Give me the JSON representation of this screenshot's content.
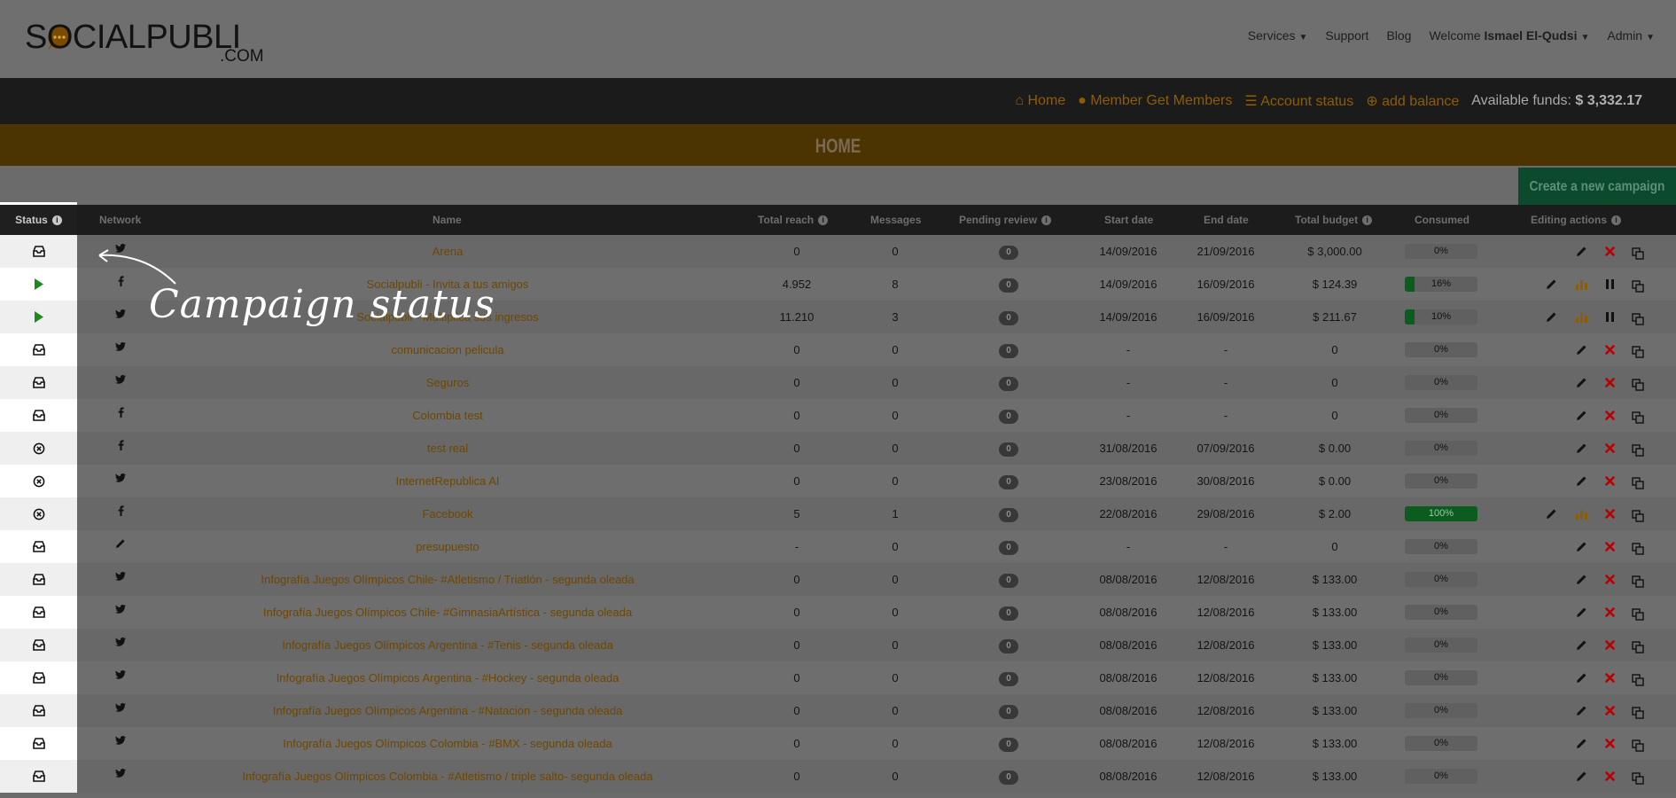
{
  "brand": {
    "logo_main": "SOCIALPUBLI",
    "logo_sub": ".COM"
  },
  "topnav": {
    "services": "Services",
    "support": "Support",
    "blog": "Blog",
    "welcome": "Welcome",
    "user": "Ismael El-Qudsi",
    "admin": "Admin"
  },
  "subnav": {
    "home": "Home",
    "member_get_members": "Member Get Members",
    "account_status": "Account status",
    "add_balance": "add balance",
    "funds_label": "Available funds:",
    "funds_value": "$ 3,332.17"
  },
  "page_title": "HOME",
  "create_button": "Create a new campaign",
  "table": {
    "headers": {
      "status": "Status",
      "network": "Network",
      "name": "Name",
      "total_reach": "Total reach",
      "messages": "Messages",
      "pending_review": "Pending review",
      "start_date": "Start date",
      "end_date": "End date",
      "total_budget": "Total budget",
      "consumed": "Consumed",
      "editing_actions": "Editing actions"
    },
    "rows": [
      {
        "status": "draft",
        "network": "twitter",
        "name": "Arena",
        "reach": "0",
        "messages": "0",
        "pending": "0",
        "start": "14/09/2016",
        "end": "21/09/2016",
        "budget": "$ 3,000.00",
        "consumed": "0%",
        "consumed_frac": 0,
        "actions": "edit"
      },
      {
        "status": "running",
        "network": "facebook",
        "name": "Socialpubli - Invita a tus amigos",
        "reach": "4.952",
        "messages": "8",
        "pending": "0",
        "start": "14/09/2016",
        "end": "16/09/2016",
        "budget": "$ 124.39",
        "consumed": "16%",
        "consumed_frac": 0.16,
        "actions": "live"
      },
      {
        "status": "running",
        "network": "twitter",
        "name": "Socialpubli - Multiplica sus ingresos",
        "reach": "11.210",
        "messages": "3",
        "pending": "0",
        "start": "14/09/2016",
        "end": "16/09/2016",
        "budget": "$ 211.67",
        "consumed": "10%",
        "consumed_frac": 0.1,
        "actions": "live"
      },
      {
        "status": "draft",
        "network": "twitter",
        "name": "comunicacion pelicula",
        "reach": "0",
        "messages": "0",
        "pending": "0",
        "start": "-",
        "end": "-",
        "budget": "0",
        "consumed": "0%",
        "consumed_frac": 0,
        "actions": "edit"
      },
      {
        "status": "draft",
        "network": "twitter",
        "name": "Seguros",
        "reach": "0",
        "messages": "0",
        "pending": "0",
        "start": "-",
        "end": "-",
        "budget": "0",
        "consumed": "0%",
        "consumed_frac": 0,
        "actions": "edit"
      },
      {
        "status": "draft",
        "network": "facebook",
        "name": "Colombia test",
        "reach": "0",
        "messages": "0",
        "pending": "0",
        "start": "-",
        "end": "-",
        "budget": "0",
        "consumed": "0%",
        "consumed_frac": 0,
        "actions": "edit"
      },
      {
        "status": "cancelled",
        "network": "facebook",
        "name": "test real",
        "reach": "0",
        "messages": "0",
        "pending": "0",
        "start": "31/08/2016",
        "end": "07/09/2016",
        "budget": "$ 0.00",
        "consumed": "0%",
        "consumed_frac": 0,
        "actions": "edit"
      },
      {
        "status": "cancelled",
        "network": "twitter",
        "name": "InternetRepublica AI",
        "reach": "0",
        "messages": "0",
        "pending": "0",
        "start": "23/08/2016",
        "end": "30/08/2016",
        "budget": "$ 0.00",
        "consumed": "0%",
        "consumed_frac": 0,
        "actions": "edit"
      },
      {
        "status": "cancelled",
        "network": "facebook",
        "name": "Facebook",
        "reach": "5",
        "messages": "1",
        "pending": "0",
        "start": "22/08/2016",
        "end": "29/08/2016",
        "budget": "$ 2.00",
        "consumed": "100%",
        "consumed_frac": 1,
        "actions": "stats"
      },
      {
        "status": "draft",
        "network": "pencil",
        "name": "presupuesto",
        "reach": "-",
        "messages": "0",
        "pending": "0",
        "start": "-",
        "end": "-",
        "budget": "0",
        "consumed": "0%",
        "consumed_frac": 0,
        "actions": "edit"
      },
      {
        "status": "draft",
        "network": "twitter",
        "name": "Infografía Juegos Olímpicos Chile- #Atletismo / Triatlón - segunda oleada",
        "reach": "0",
        "messages": "0",
        "pending": "0",
        "start": "08/08/2016",
        "end": "12/08/2016",
        "budget": "$ 133.00",
        "consumed": "0%",
        "consumed_frac": 0,
        "actions": "edit"
      },
      {
        "status": "draft",
        "network": "twitter",
        "name": "Infografía Juegos Olímpicos Chile- #GimnasiaArtística - segunda oleada",
        "reach": "0",
        "messages": "0",
        "pending": "0",
        "start": "08/08/2016",
        "end": "12/08/2016",
        "budget": "$ 133.00",
        "consumed": "0%",
        "consumed_frac": 0,
        "actions": "edit"
      },
      {
        "status": "draft",
        "network": "twitter",
        "name": "Infografía Juegos Olímpicos Argentina - #Tenis - segunda oleada",
        "reach": "0",
        "messages": "0",
        "pending": "0",
        "start": "08/08/2016",
        "end": "12/08/2016",
        "budget": "$ 133.00",
        "consumed": "0%",
        "consumed_frac": 0,
        "actions": "edit"
      },
      {
        "status": "draft",
        "network": "twitter",
        "name": "Infografía Juegos Olímpicos Argentina - #Hockey - segunda oleada",
        "reach": "0",
        "messages": "0",
        "pending": "0",
        "start": "08/08/2016",
        "end": "12/08/2016",
        "budget": "$ 133.00",
        "consumed": "0%",
        "consumed_frac": 0,
        "actions": "edit"
      },
      {
        "status": "draft",
        "network": "twitter",
        "name": "Infografía Juegos Olímpicos Argentina - #Natacion - segunda oleada",
        "reach": "0",
        "messages": "0",
        "pending": "0",
        "start": "08/08/2016",
        "end": "12/08/2016",
        "budget": "$ 133.00",
        "consumed": "0%",
        "consumed_frac": 0,
        "actions": "edit"
      },
      {
        "status": "draft",
        "network": "twitter",
        "name": "Infografía Juegos Olímpicos Colombia - #BMX - segunda oleada",
        "reach": "0",
        "messages": "0",
        "pending": "0",
        "start": "08/08/2016",
        "end": "12/08/2016",
        "budget": "$ 133.00",
        "consumed": "0%",
        "consumed_frac": 0,
        "actions": "edit"
      },
      {
        "status": "draft",
        "network": "twitter",
        "name": "Infografía Juegos Olímpicos Colombia - #Atletismo / triple salto- segunda oleada",
        "reach": "0",
        "messages": "0",
        "pending": "0",
        "start": "08/08/2016",
        "end": "12/08/2016",
        "budget": "$ 133.00",
        "consumed": "0%",
        "consumed_frac": 0,
        "actions": "edit"
      }
    ]
  },
  "annotation": {
    "text": "Campaign status"
  },
  "colors": {
    "accent": "#8e5c02",
    "green": "#0c5b1f",
    "red": "#b80000",
    "status_running": "#1e8a1e"
  }
}
